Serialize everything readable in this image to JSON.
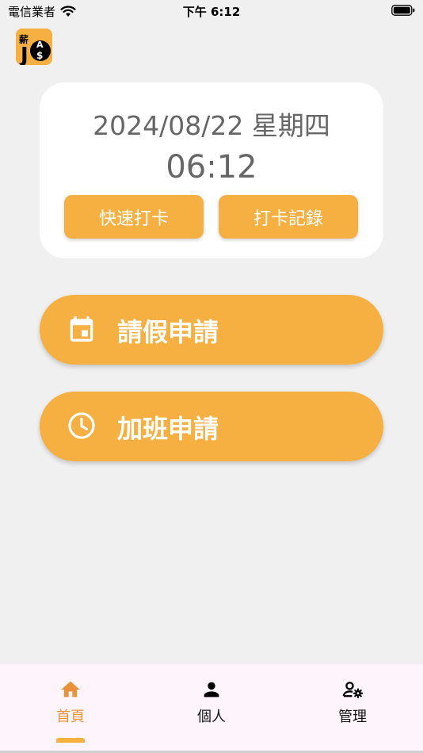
{
  "status_bar": {
    "carrier": "電信業者",
    "time": "下午 6:12"
  },
  "app": {
    "logo_text": "薪JB$"
  },
  "clock_card": {
    "date": "2024/08/22 星期四",
    "time": "06:12",
    "quick_punch_label": "快速打卡",
    "punch_records_label": "打卡記錄"
  },
  "actions": {
    "leave_label": "請假申請",
    "leave_icon": "calendar-icon",
    "overtime_label": "加班申請",
    "overtime_icon": "clock-icon"
  },
  "tabs": [
    {
      "label": "首頁",
      "icon": "home-icon",
      "active": true
    },
    {
      "label": "個人",
      "icon": "person-icon",
      "active": false
    },
    {
      "label": "管理",
      "icon": "user-gear-icon",
      "active": false
    }
  ],
  "colors": {
    "accent": "#f6b042",
    "active_tab": "#e8923a",
    "background": "#f0f0f0"
  }
}
